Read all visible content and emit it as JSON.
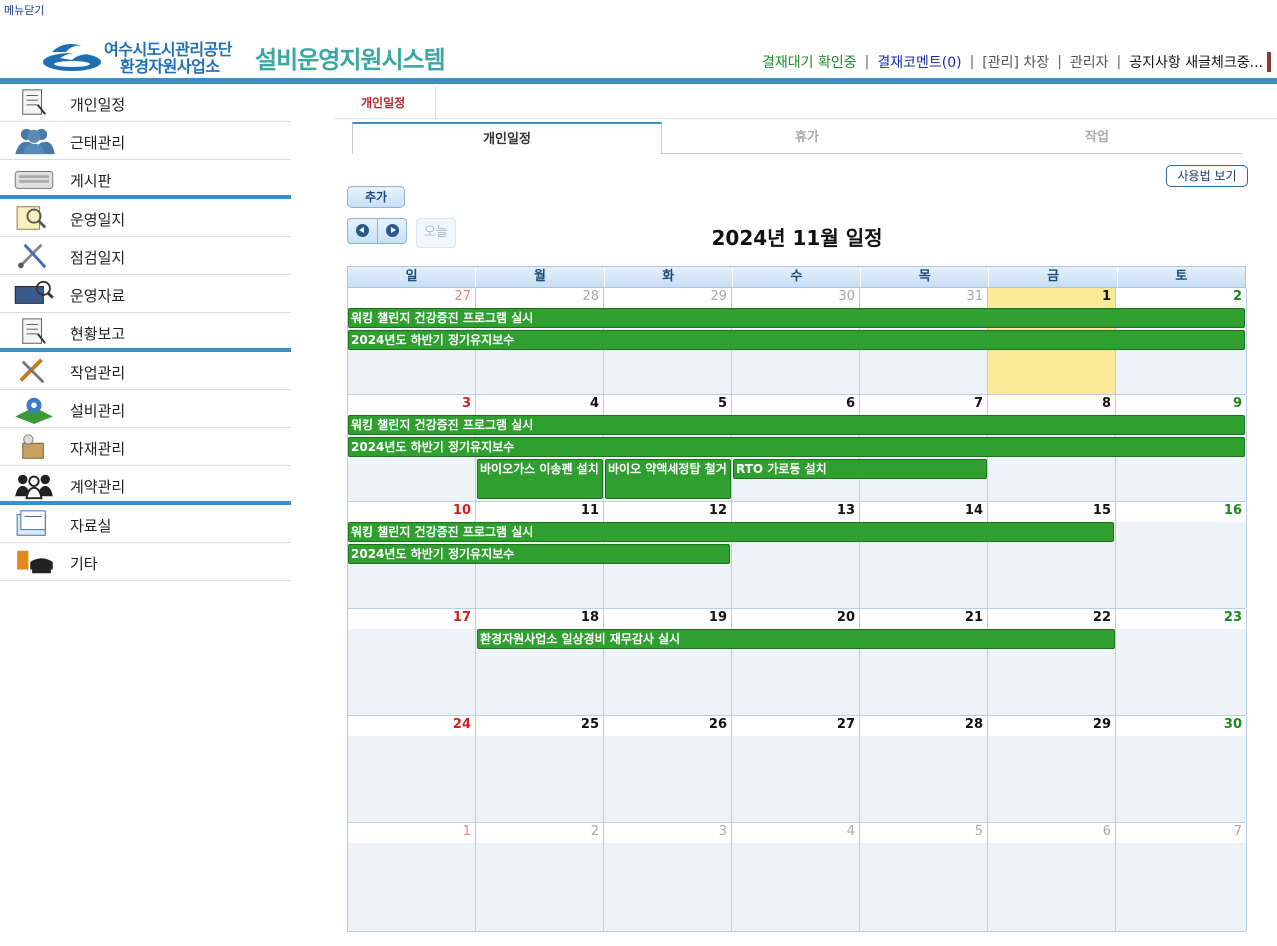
{
  "top_link": "메뉴닫기",
  "logo": {
    "org_line1": "여수시도시관리공단",
    "org_line2": "환경자원사업소",
    "system_name": "설비운영지원시스템"
  },
  "topnav": {
    "approval": "결재대기 확인중",
    "comment": "결재코멘트(0)",
    "role": "[관리] 차장",
    "admin": "관리자",
    "notice": "공지사항 새글체크중..."
  },
  "sidebar": {
    "items": [
      {
        "label": "개인일정",
        "icon": "document-icon"
      },
      {
        "label": "근태관리",
        "icon": "people-icon"
      },
      {
        "label": "게시판",
        "icon": "keyboard-icon"
      },
      {
        "label": "운영일지",
        "icon": "notepad-icon"
      },
      {
        "label": "점검일지",
        "icon": "tools-icon"
      },
      {
        "label": "운영자료",
        "icon": "monitor-search-icon"
      },
      {
        "label": "현황보고",
        "icon": "report-icon"
      },
      {
        "label": "작업관리",
        "icon": "wrench-icon"
      },
      {
        "label": "설비관리",
        "icon": "facility-icon"
      },
      {
        "label": "자재관리",
        "icon": "box-icon"
      },
      {
        "label": "계약관리",
        "icon": "contract-people-icon"
      },
      {
        "label": "자료실",
        "icon": "folder-icon"
      },
      {
        "label": "기타",
        "icon": "phone-icon"
      }
    ]
  },
  "main_tab": "개인일정",
  "subtabs": [
    "개인일정",
    "휴가",
    "작업"
  ],
  "help_button": "사용법 보기",
  "add_button": "추가",
  "today_button": "오늘",
  "calendar": {
    "title": "2024년 11월 일정",
    "weekdays": [
      "일",
      "월",
      "화",
      "수",
      "목",
      "금",
      "토"
    ],
    "weeks": [
      {
        "days": [
          "27",
          "28",
          "29",
          "30",
          "31",
          "1",
          "2"
        ],
        "other": [
          true,
          true,
          true,
          true,
          true,
          false,
          false
        ]
      },
      {
        "days": [
          "3",
          "4",
          "5",
          "6",
          "7",
          "8",
          "9"
        ],
        "other": [
          false,
          false,
          false,
          false,
          false,
          false,
          false
        ]
      },
      {
        "days": [
          "10",
          "11",
          "12",
          "13",
          "14",
          "15",
          "16"
        ],
        "other": [
          false,
          false,
          false,
          false,
          false,
          false,
          false
        ]
      },
      {
        "days": [
          "17",
          "18",
          "19",
          "20",
          "21",
          "22",
          "23"
        ],
        "other": [
          false,
          false,
          false,
          false,
          false,
          false,
          false
        ]
      },
      {
        "days": [
          "24",
          "25",
          "26",
          "27",
          "28",
          "29",
          "30"
        ],
        "other": [
          false,
          false,
          false,
          false,
          false,
          false,
          false
        ]
      },
      {
        "days": [
          "1",
          "2",
          "3",
          "4",
          "5",
          "6",
          "7"
        ],
        "other": [
          true,
          true,
          true,
          true,
          true,
          true,
          true
        ]
      }
    ],
    "today": {
      "week": 0,
      "day": 5
    },
    "events": [
      {
        "title": "워킹 챌린지 건강증진 프로그램 실시",
        "week": 0,
        "start": 0,
        "span": 7,
        "row": 0
      },
      {
        "title": "2024년도 하반기 정기유지보수",
        "week": 0,
        "start": 0,
        "span": 7,
        "row": 1
      },
      {
        "title": "워킹 챌린지 건강증진 프로그램 실시",
        "week": 1,
        "start": 0,
        "span": 7,
        "row": 0
      },
      {
        "title": "2024년도 하반기 정기유지보수",
        "week": 1,
        "start": 0,
        "span": 7,
        "row": 1
      },
      {
        "title": "바이오가스 이송펜 설치",
        "week": 1,
        "start": 1,
        "span": 1,
        "row": 2
      },
      {
        "title": "바이오 약액세정탑 철거",
        "week": 1,
        "start": 2,
        "span": 1,
        "row": 2
      },
      {
        "title": "RTO 가로등 설치",
        "week": 1,
        "start": 3,
        "span": 2,
        "row": 2
      },
      {
        "title": "워킹 챌린지 건강증진 프로그램 실시",
        "week": 2,
        "start": 0,
        "span": 6,
        "row": 0
      },
      {
        "title": "2024년도 하반기 정기유지보수",
        "week": 2,
        "start": 0,
        "span": 3,
        "row": 1
      },
      {
        "title": "환경자원사업소 일상경비 재무감사 실시",
        "week": 3,
        "start": 1,
        "span": 5,
        "row": 0
      }
    ]
  }
}
